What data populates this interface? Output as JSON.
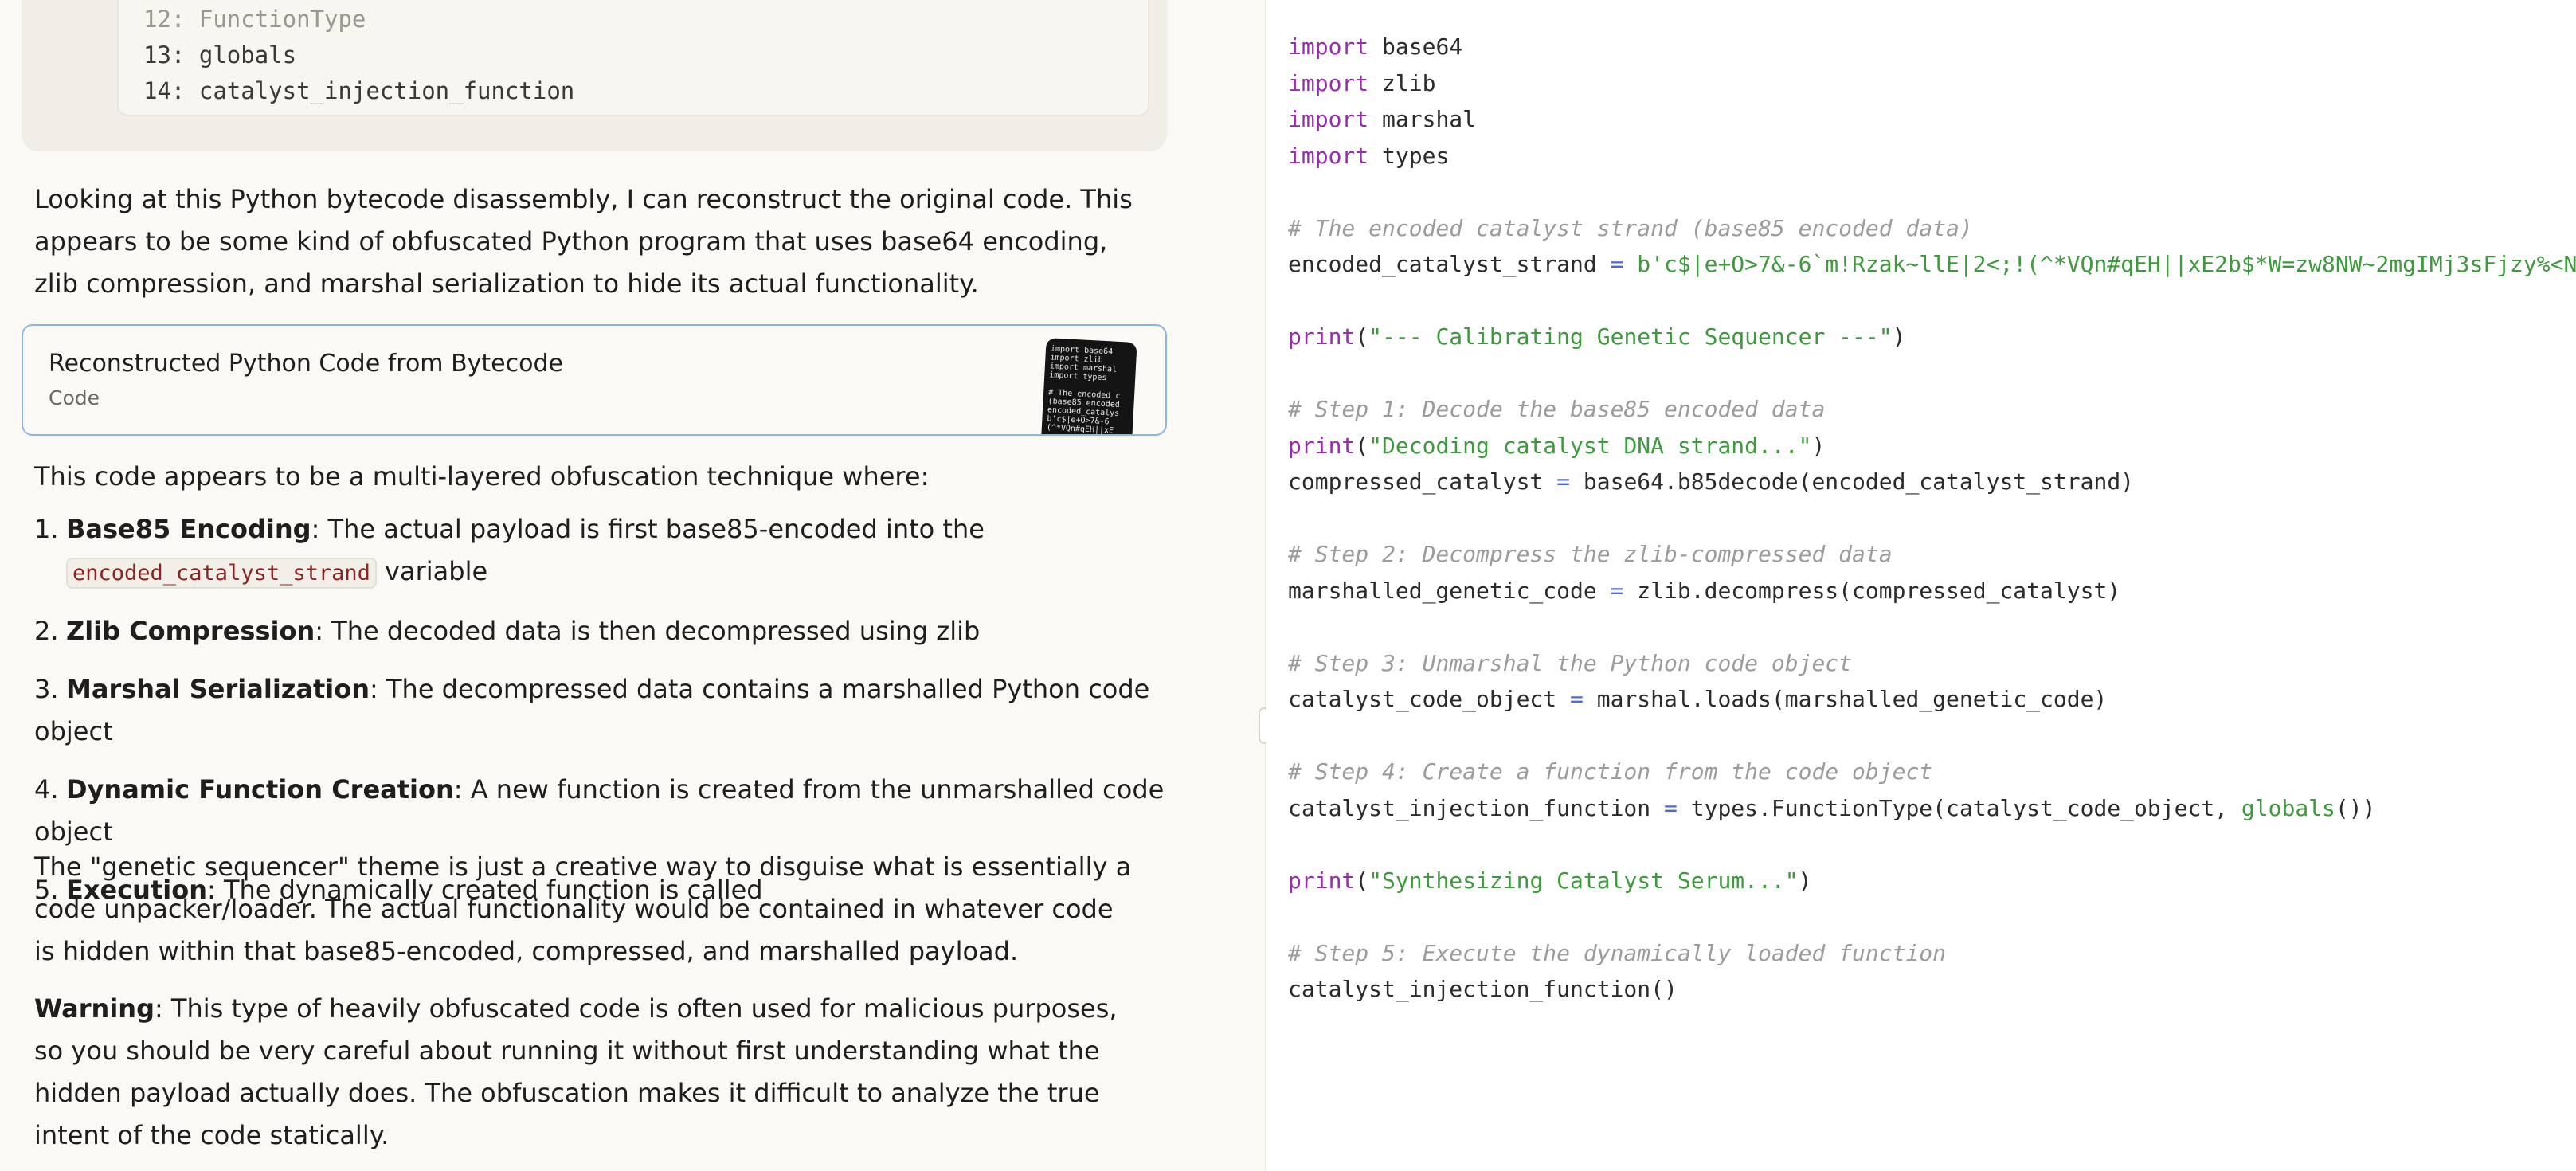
{
  "tool_output": {
    "lines": [
      {
        "num": "12:",
        "text": "FunctionType"
      },
      {
        "num": "13:",
        "text": "globals"
      },
      {
        "num": "14:",
        "text": "catalyst_injection_function"
      }
    ]
  },
  "chat": {
    "intro": "Looking at this Python bytecode disassembly, I can reconstruct the original code. This appears to be some kind of obfuscated Python program that uses base64 encoding, zlib compression, and marshal serialization to hide its actual functionality.",
    "artifact_card": {
      "title": "Reconstructed Python Code from Bytecode",
      "subtitle": "Code",
      "thumb_text": "import base64\nimport zlib\nimport marshal\nimport types\n\n# The encoded c\n(base85 encoded\nencoded_catalys\nb'c$|e+O>7&-6\n(^*VQn#qEH||xE"
    },
    "lead": "This code appears to be a multi-layered obfuscation technique where:",
    "steps": [
      {
        "num": "1.",
        "bold": "Base85 Encoding",
        "text": ": The actual payload is first base85-encoded into the",
        "code": "encoded_catalyst_strand",
        "after": " variable"
      },
      {
        "num": "2.",
        "bold": "Zlib Compression",
        "text": ": The decoded data is then decompressed using zlib"
      },
      {
        "num": "3.",
        "bold": "Marshal Serialization",
        "text": ": The decompressed data contains a marshalled Python code object"
      },
      {
        "num": "4.",
        "bold": "Dynamic Function Creation",
        "text": ": A new function is created from the unmarshalled code object"
      },
      {
        "num": "5.",
        "bold": "Execution",
        "text": ": The dynamically created function is called"
      }
    ],
    "theme_paragraph": "The \"genetic sequencer\" theme is just a creative way to disguise what is essentially a code unpacker/loader. The actual functionality would be contained in whatever code is hidden within that base85-encoded, compressed, and marshalled payload.",
    "warning_label": "Warning",
    "warning_text": ": This type of heavily obfuscated code is often used for malicious purposes, so you should be very careful about running it without first understanding what the hidden payload actually does. The obfuscation makes it difficult to analyze the true intent of the code statically."
  },
  "code": {
    "l1_kw": "import",
    "l1_rest": " base64",
    "l2_kw": "import",
    "l2_rest": " zlib",
    "l3_kw": "import",
    "l3_rest": " marshal",
    "l4_kw": "import",
    "l4_rest": " types",
    "c1": "# The encoded catalyst strand (base85 encoded data)",
    "l6_var": "encoded_catalyst_strand ",
    "l6_op": "=",
    "l6_str": " b'c$|e+O>7&-6`m!Rzak~llE|2<;!(^*VQn#qEH||xE2b$*W=zw8NW~2mgIMj3sFjzy%<N",
    "l8_fn": "print",
    "l8_a": "(",
    "l8_str": "\"--- Calibrating Genetic Sequencer ---\"",
    "l8_b": ")",
    "c2": "# Step 1: Decode the base85 encoded data",
    "l11_fn": "print",
    "l11_a": "(",
    "l11_str": "\"Decoding catalyst DNA strand...\"",
    "l11_b": ")",
    "l12_var": "compressed_catalyst ",
    "l12_op": "=",
    "l12_rest": " base64.b85decode(encoded_catalyst_strand)",
    "c3": "# Step 2: Decompress the zlib-compressed data",
    "l15_var": "marshalled_genetic_code ",
    "l15_op": "=",
    "l15_rest": " zlib.decompress(compressed_catalyst)",
    "c4": "# Step 3: Unmarshal the Python code object",
    "l18_var": "catalyst_code_object ",
    "l18_op": "=",
    "l18_rest": " marshal.loads(marshalled_genetic_code)",
    "c5": "# Step 4: Create a function from the code object",
    "l21_var": "catalyst_injection_function ",
    "l21_op": "=",
    "l21_rest": " types.FunctionType(catalyst_code_object, ",
    "l21_bi": "globals",
    "l21_end": "())",
    "l23_fn": "print",
    "l23_a": "(",
    "l23_str": "\"Synthesizing Catalyst Serum...\"",
    "l23_b": ")",
    "c6": "# Step 5: Execute the dynamically loaded function",
    "l26": "catalyst_injection_function()"
  }
}
